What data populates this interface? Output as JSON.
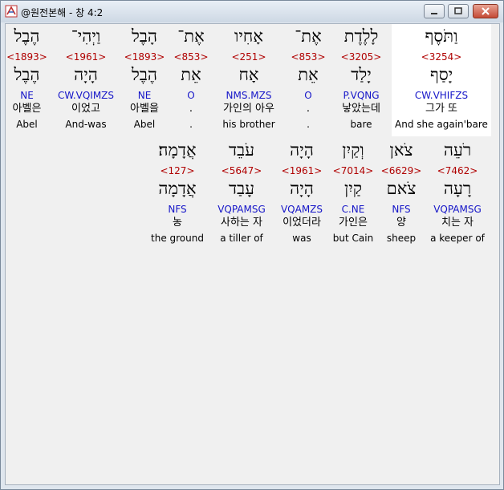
{
  "window": {
    "title": "@원전본해 - 창 4:2"
  },
  "icons": {
    "app": "book-icon",
    "minimize": "minimize-icon",
    "maximize": "maximize-icon",
    "close": "close-icon"
  },
  "colors": {
    "number": "#b00000",
    "parse": "#1515c8",
    "highlight": "#ffffff"
  },
  "rows": [
    {
      "words": [
        {
          "heb": "הֶבֶל",
          "num": "<1893>",
          "root": "הֶבֶל",
          "parse": "NE",
          "kor": "아벨은",
          "eng": "Abel"
        },
        {
          "heb": "וַיְהִי־",
          "num": "<1961>",
          "root": "הָיָה",
          "parse": "CW.VQIMZS",
          "kor": "이었고",
          "eng": "And-was"
        },
        {
          "heb": "הָבֶל",
          "num": "<1893>",
          "root": "הֶבֶל",
          "parse": "NE",
          "kor": "아벨을",
          "eng": "Abel"
        },
        {
          "heb": "אֶת־",
          "num": "<853>",
          "root": "אֵת",
          "parse": "O",
          "kor": ".",
          "eng": "."
        },
        {
          "heb": "אָחִיו",
          "num": "<251>",
          "root": "אָח",
          "parse": "NMS.MZS",
          "kor": "가인의 아우",
          "eng": "his brother"
        },
        {
          "heb": "אֶת־",
          "num": "<853>",
          "root": "אֵת",
          "parse": "O",
          "kor": ".",
          "eng": "."
        },
        {
          "heb": "לָלֶדֶת",
          "num": "<3205>",
          "root": "יָלַד",
          "parse": "P.VQNG",
          "kor": "낳았는데",
          "eng": "bare"
        },
        {
          "heb": "וַתֹּסֶף",
          "num": "<3254>",
          "root": "יָסַף",
          "parse": "CW.VHIFZS",
          "kor": "그가 또",
          "eng": "And she again'bare",
          "highlighted": true
        }
      ]
    },
    {
      "words": [
        {
          "heb": "אֲדָמָה׃",
          "num": "<127>",
          "root": "אֲדָמָה",
          "parse": "NFS",
          "kor": "농",
          "eng": "the ground"
        },
        {
          "heb": "עֹבֵד",
          "num": "<5647>",
          "root": "עָבַד",
          "parse": "VQPAMSG",
          "kor": "사하는 자",
          "eng": "a tiller of"
        },
        {
          "heb": "הָיָה",
          "num": "<1961>",
          "root": "הָיָה",
          "parse": "VQAMZS",
          "kor": "이었더라",
          "eng": "was"
        },
        {
          "heb": "וְקַיִן",
          "num": "<7014>",
          "root": "קַיִן",
          "parse": "C.NE",
          "kor": "가인은",
          "eng": "but Cain"
        },
        {
          "heb": "צֹאן",
          "num": "<6629>",
          "root": "צֹאם",
          "parse": "NFS",
          "kor": "양",
          "eng": "sheep"
        },
        {
          "heb": "רֹעֵה",
          "num": "<7462>",
          "root": "רָעָה",
          "parse": "VQPAMSG",
          "kor": "치는 자",
          "eng": "a keeper of"
        }
      ]
    }
  ]
}
